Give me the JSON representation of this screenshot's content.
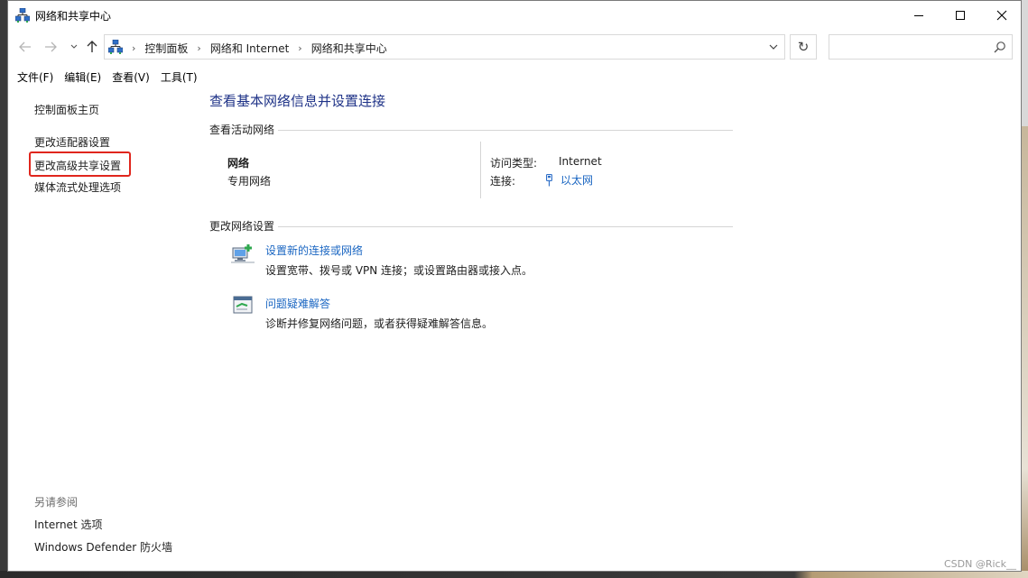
{
  "window": {
    "title": "网络和共享中心"
  },
  "address_bar": {
    "breadcrumbs": [
      "控制面板",
      "网络和 Internet",
      "网络和共享中心"
    ],
    "search_placeholder": ""
  },
  "menu": {
    "items": [
      "文件(F)",
      "编辑(E)",
      "查看(V)",
      "工具(T)"
    ]
  },
  "sidebar": {
    "home": "控制面板主页",
    "items": [
      "更改适配器设置",
      "更改高级共享设置",
      "媒体流式处理选项"
    ],
    "highlighted_item": "更改高级共享设置",
    "highlight_color": "#e0261d",
    "see_also_title": "另请参阅",
    "see_also": [
      "Internet 选项",
      "Windows Defender 防火墙"
    ]
  },
  "main": {
    "title": "查看基本网络信息并设置连接",
    "active_networks_header": "查看活动网络",
    "network": {
      "name": "网络",
      "type": "专用网络",
      "access_type_label": "访问类型:",
      "access_type_value": "Internet",
      "connections_label": "连接:",
      "connection_value": "以太网"
    },
    "change_settings_header": "更改网络设置",
    "tasks": [
      {
        "icon": "new-connection-icon",
        "link": "设置新的连接或网络",
        "desc": "设置宽带、拨号或 VPN 连接；或设置路由器或接入点。"
      },
      {
        "icon": "troubleshoot-icon",
        "link": "问题疑难解答",
        "desc": "诊断并修复网络问题，或者获得疑难解答信息。"
      }
    ]
  },
  "colors": {
    "title_blue": "#1e3287",
    "link_blue": "#1a66c2"
  },
  "watermark": "CSDN @Rick__"
}
